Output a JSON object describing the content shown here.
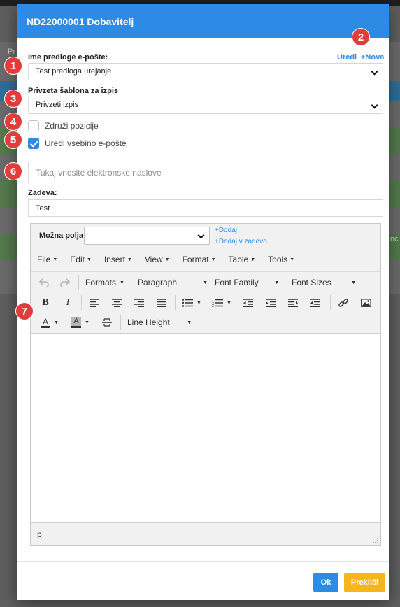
{
  "modal": {
    "title": "ND22000001 Dobavitelj",
    "template_label": "Ime predloge e-pošte:",
    "template_edit_link": "Uredi",
    "template_new_link": "+Nova",
    "template_value": "Test predloga urejanje",
    "print_label": "Privzeta šablona za izpis",
    "print_value": "Privzeti izpis",
    "merge_label": "Združi pozicije",
    "merge_checked": false,
    "edit_body_label": "Uredi vsebino e-pošte",
    "edit_body_checked": true,
    "email_placeholder": "Tukaj vnesite elektronske naslove",
    "subject_label": "Zadeva:",
    "subject_value": "Test",
    "ok_label": "Ok",
    "cancel_label": "Prekliči"
  },
  "editor": {
    "fields_label": "Možna polja:",
    "fields_value": "",
    "add_link": "+Dodaj",
    "add_subject_link": "+Dodaj v zadevo",
    "menus": [
      "File",
      "Edit",
      "Insert",
      "View",
      "Format",
      "Table",
      "Tools"
    ],
    "formats_label": "Formats",
    "paragraph_label": "Paragraph",
    "font_family_label": "Font Family",
    "font_sizes_label": "Font Sizes",
    "line_height_label": "Line Height",
    "status_path": "p"
  },
  "badges": [
    "1",
    "2",
    "3",
    "4",
    "5",
    "6",
    "7"
  ],
  "background": {
    "frag_left": "Pr",
    "frag_right": "nc"
  },
  "colors": {
    "accent": "#2d8ae5",
    "cancel": "#f6b51c",
    "badge": "#e23d3d"
  }
}
